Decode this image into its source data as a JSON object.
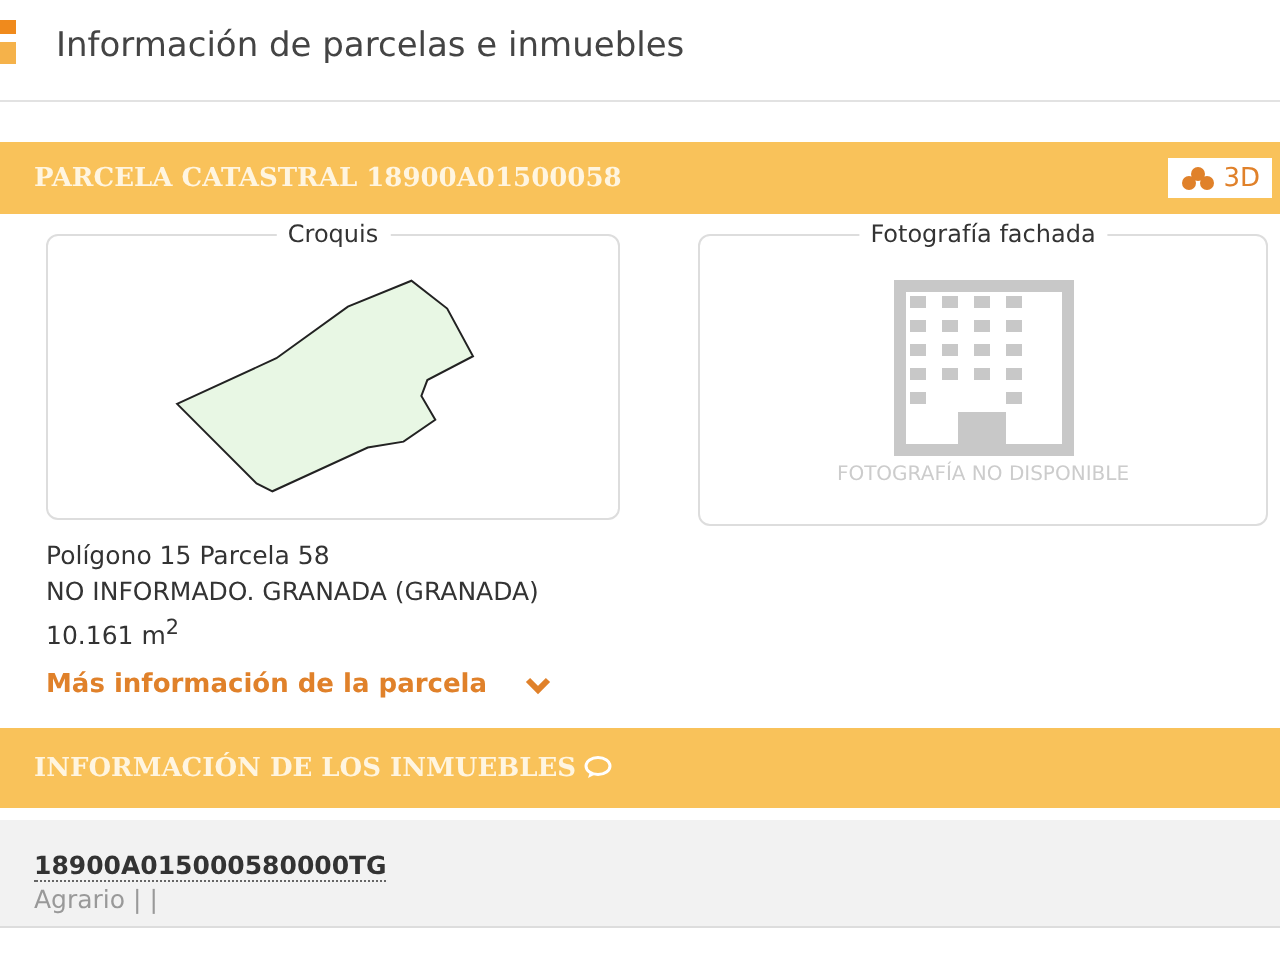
{
  "header": {
    "title": "Información de parcelas e inmuebles"
  },
  "parcel": {
    "title": "PARCELA CATASTRAL 18900A01500058",
    "button_3d": "3D",
    "sketch_label": "Croquis",
    "photo_label": "Fotografía fachada",
    "photo_missing": "FOTOGRAFÍA NO DISPONIBLE",
    "lines": [
      "Polígono 15 Parcela 58",
      "NO INFORMADO. GRANADA (GRANADA)",
      "10.161 m$^{2}$"
    ],
    "more_link": "Más información de la parcela",
    "expanded": false
  },
  "properties": {
    "title": "INFORMACIÓN DE LOS INMUEBLES",
    "items": [
      {
        "reference": "18900A015000580000TG",
        "use": "Agrario",
        "separators": [
          "|",
          "|"
        ]
      }
    ]
  }
}
